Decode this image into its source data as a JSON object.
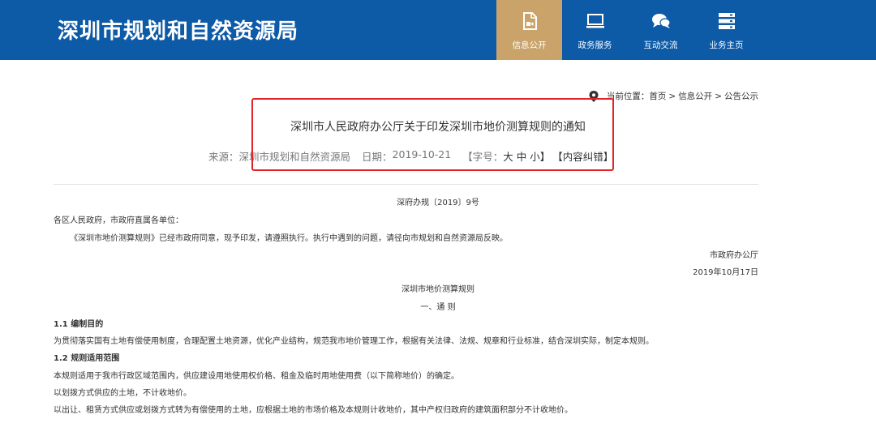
{
  "header": {
    "site_title": "深圳市规划和自然资源局",
    "nav": [
      {
        "label": "信息公开",
        "icon": "document-video-icon",
        "active": true
      },
      {
        "label": "政务服务",
        "icon": "monitor-icon",
        "active": false
      },
      {
        "label": "互动交流",
        "icon": "chat-bubbles-icon",
        "active": false
      },
      {
        "label": "业务主页",
        "icon": "server-stack-icon",
        "active": false
      }
    ],
    "colors": {
      "bar": "#0d5aa7",
      "active": "#c9a36a"
    }
  },
  "breadcrumb": {
    "prefix": "当前位置：",
    "items": [
      "首页",
      "信息公开",
      "公告公示"
    ],
    "separator": ">"
  },
  "article": {
    "title": "深圳市人民政府办公厅关于印发深圳市地价测算规则的通知",
    "source_label": "来源：",
    "source": "深圳市规划和自然资源局",
    "date_label": "日期：",
    "date": "2019-10-21",
    "font_size_label": "【字号：",
    "font_size_large": "大",
    "font_size_medium": "中",
    "font_size_small": "小",
    "font_size_close": "】",
    "error_report": "【内容纠错】",
    "highlight_color": "#e32424"
  },
  "content": {
    "doc_number": "深府办规〔2019〕9号",
    "addressee": "各区人民政府，市政府直属各单位：",
    "notice": "《深圳市地价测算规则》已经市政府同意，现予印发，请遵照执行。执行中遇到的问题，请径向市规划和自然资源局反映。",
    "issuer": "市政府办公厅",
    "issue_date": "2019年10月17日",
    "rules_title": "深圳市地价测算规则",
    "chapter_title": "一、通  则",
    "s11_heading": "1.1  编制目的",
    "s11_text": "为贯彻落实国有土地有偿使用制度，合理配置土地资源，优化产业结构，规范我市地价管理工作，根据有关法律、法规、规章和行业标准，结合深圳实际，制定本规则。",
    "s12_heading": "1.2  规则适用范围",
    "s12_text1": "本规则适用于我市行政区域范围内，供应建设用地使用权价格、租金及临时用地使用费（以下简称地价）的确定。",
    "s12_text2": "以划拨方式供应的土地，不计收地价。",
    "s12_text3": "以出让、租赁方式供应或划拨方式转为有偿使用的土地，应根据土地的市场价格及本规则计收地价，其中产权归政府的建筑面积部分不计收地价。"
  }
}
